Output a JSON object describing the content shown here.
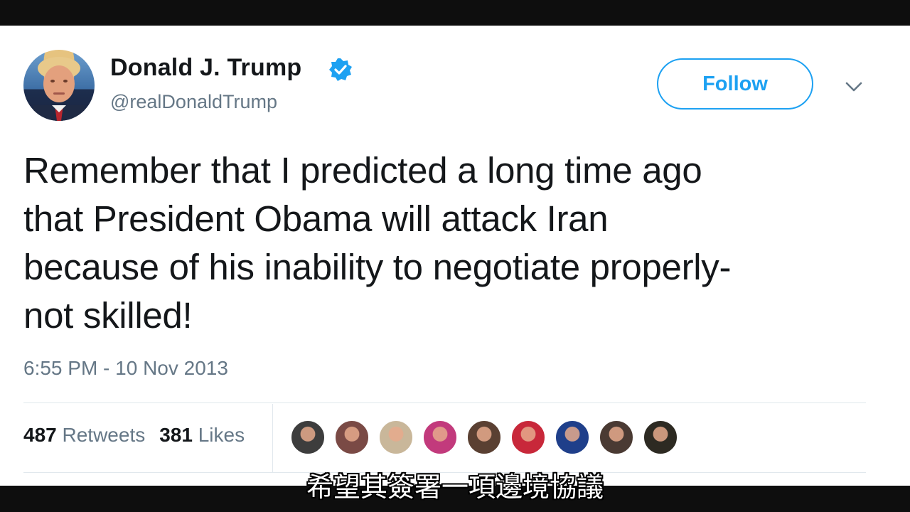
{
  "tweet": {
    "author": {
      "name": "Donald J. Trump",
      "handle": "@realDonaldTrump",
      "verified": true
    },
    "follow_label": "Follow",
    "text_lines": [
      "Remember that I predicted a long time ago",
      "that President Obama will attack Iran",
      "because of his inability to negotiate properly-",
      "not skilled!"
    ],
    "timestamp": "6:55 PM - 10 Nov 2013",
    "stats": {
      "retweets_count": "487",
      "retweets_label": "Retweets",
      "likes_count": "381",
      "likes_label": "Likes"
    },
    "liker_avatar_colors": [
      "#3d3d3d",
      "#7a4a45",
      "#c9b79a",
      "#c23a7c",
      "#5a4032",
      "#c8283a",
      "#1f3f8a",
      "#4a3a33",
      "#2d2a22"
    ]
  },
  "subtitle": "希望其簽署一項邊境協議",
  "colors": {
    "accent": "#1da1f2",
    "secondary_text": "#657786",
    "primary_text": "#14171a"
  }
}
